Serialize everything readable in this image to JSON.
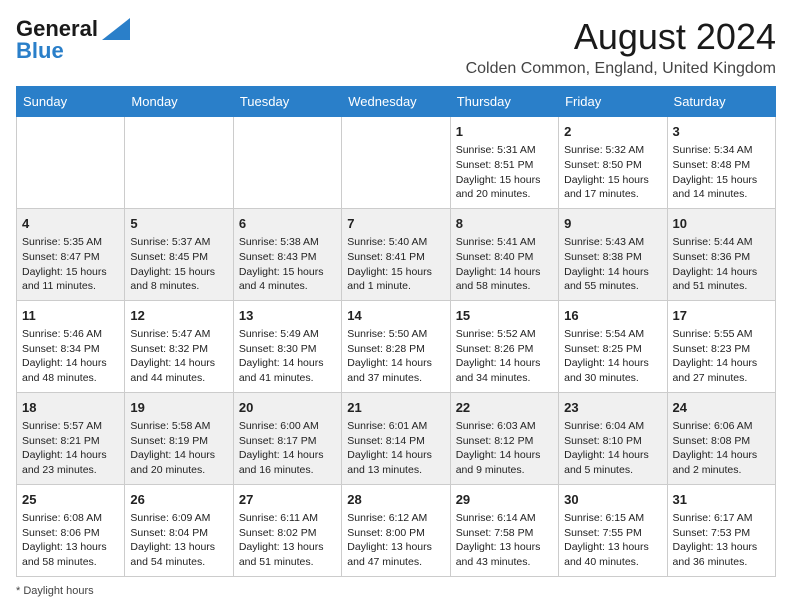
{
  "header": {
    "logo_line1": "General",
    "logo_line2": "Blue",
    "month_title": "August 2024",
    "location": "Colden Common, England, United Kingdom"
  },
  "weekdays": [
    "Sunday",
    "Monday",
    "Tuesday",
    "Wednesday",
    "Thursday",
    "Friday",
    "Saturday"
  ],
  "footer": {
    "daylight_label": "Daylight hours"
  },
  "weeks": [
    [
      {
        "day": "",
        "info": ""
      },
      {
        "day": "",
        "info": ""
      },
      {
        "day": "",
        "info": ""
      },
      {
        "day": "",
        "info": ""
      },
      {
        "day": "1",
        "info": "Sunrise: 5:31 AM\nSunset: 8:51 PM\nDaylight: 15 hours and 20 minutes."
      },
      {
        "day": "2",
        "info": "Sunrise: 5:32 AM\nSunset: 8:50 PM\nDaylight: 15 hours and 17 minutes."
      },
      {
        "day": "3",
        "info": "Sunrise: 5:34 AM\nSunset: 8:48 PM\nDaylight: 15 hours and 14 minutes."
      }
    ],
    [
      {
        "day": "4",
        "info": "Sunrise: 5:35 AM\nSunset: 8:47 PM\nDaylight: 15 hours and 11 minutes."
      },
      {
        "day": "5",
        "info": "Sunrise: 5:37 AM\nSunset: 8:45 PM\nDaylight: 15 hours and 8 minutes."
      },
      {
        "day": "6",
        "info": "Sunrise: 5:38 AM\nSunset: 8:43 PM\nDaylight: 15 hours and 4 minutes."
      },
      {
        "day": "7",
        "info": "Sunrise: 5:40 AM\nSunset: 8:41 PM\nDaylight: 15 hours and 1 minute."
      },
      {
        "day": "8",
        "info": "Sunrise: 5:41 AM\nSunset: 8:40 PM\nDaylight: 14 hours and 58 minutes."
      },
      {
        "day": "9",
        "info": "Sunrise: 5:43 AM\nSunset: 8:38 PM\nDaylight: 14 hours and 55 minutes."
      },
      {
        "day": "10",
        "info": "Sunrise: 5:44 AM\nSunset: 8:36 PM\nDaylight: 14 hours and 51 minutes."
      }
    ],
    [
      {
        "day": "11",
        "info": "Sunrise: 5:46 AM\nSunset: 8:34 PM\nDaylight: 14 hours and 48 minutes."
      },
      {
        "day": "12",
        "info": "Sunrise: 5:47 AM\nSunset: 8:32 PM\nDaylight: 14 hours and 44 minutes."
      },
      {
        "day": "13",
        "info": "Sunrise: 5:49 AM\nSunset: 8:30 PM\nDaylight: 14 hours and 41 minutes."
      },
      {
        "day": "14",
        "info": "Sunrise: 5:50 AM\nSunset: 8:28 PM\nDaylight: 14 hours and 37 minutes."
      },
      {
        "day": "15",
        "info": "Sunrise: 5:52 AM\nSunset: 8:26 PM\nDaylight: 14 hours and 34 minutes."
      },
      {
        "day": "16",
        "info": "Sunrise: 5:54 AM\nSunset: 8:25 PM\nDaylight: 14 hours and 30 minutes."
      },
      {
        "day": "17",
        "info": "Sunrise: 5:55 AM\nSunset: 8:23 PM\nDaylight: 14 hours and 27 minutes."
      }
    ],
    [
      {
        "day": "18",
        "info": "Sunrise: 5:57 AM\nSunset: 8:21 PM\nDaylight: 14 hours and 23 minutes."
      },
      {
        "day": "19",
        "info": "Sunrise: 5:58 AM\nSunset: 8:19 PM\nDaylight: 14 hours and 20 minutes."
      },
      {
        "day": "20",
        "info": "Sunrise: 6:00 AM\nSunset: 8:17 PM\nDaylight: 14 hours and 16 minutes."
      },
      {
        "day": "21",
        "info": "Sunrise: 6:01 AM\nSunset: 8:14 PM\nDaylight: 14 hours and 13 minutes."
      },
      {
        "day": "22",
        "info": "Sunrise: 6:03 AM\nSunset: 8:12 PM\nDaylight: 14 hours and 9 minutes."
      },
      {
        "day": "23",
        "info": "Sunrise: 6:04 AM\nSunset: 8:10 PM\nDaylight: 14 hours and 5 minutes."
      },
      {
        "day": "24",
        "info": "Sunrise: 6:06 AM\nSunset: 8:08 PM\nDaylight: 14 hours and 2 minutes."
      }
    ],
    [
      {
        "day": "25",
        "info": "Sunrise: 6:08 AM\nSunset: 8:06 PM\nDaylight: 13 hours and 58 minutes."
      },
      {
        "day": "26",
        "info": "Sunrise: 6:09 AM\nSunset: 8:04 PM\nDaylight: 13 hours and 54 minutes."
      },
      {
        "day": "27",
        "info": "Sunrise: 6:11 AM\nSunset: 8:02 PM\nDaylight: 13 hours and 51 minutes."
      },
      {
        "day": "28",
        "info": "Sunrise: 6:12 AM\nSunset: 8:00 PM\nDaylight: 13 hours and 47 minutes."
      },
      {
        "day": "29",
        "info": "Sunrise: 6:14 AM\nSunset: 7:58 PM\nDaylight: 13 hours and 43 minutes."
      },
      {
        "day": "30",
        "info": "Sunrise: 6:15 AM\nSunset: 7:55 PM\nDaylight: 13 hours and 40 minutes."
      },
      {
        "day": "31",
        "info": "Sunrise: 6:17 AM\nSunset: 7:53 PM\nDaylight: 13 hours and 36 minutes."
      }
    ]
  ]
}
